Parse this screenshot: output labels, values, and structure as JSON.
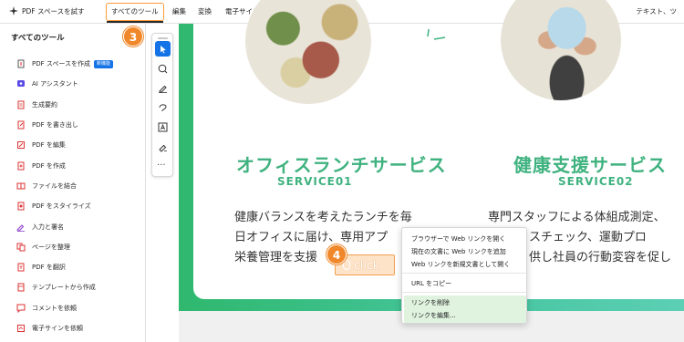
{
  "toolbar": {
    "try_space": "PDF スペースを試す",
    "all_tools": "すべてのツール",
    "edit": "編集",
    "convert": "変換",
    "esign": "電子サイン",
    "right_label": "テキスト、ツ"
  },
  "left_panel": {
    "title": "すべてのツール",
    "items": [
      {
        "label": "PDF スペースを作成",
        "badge": "新機能",
        "icon": "pdf-space-icon"
      },
      {
        "label": "AI アシスタント",
        "icon": "ai-assistant-icon"
      },
      {
        "label": "生成要約",
        "icon": "summary-icon"
      },
      {
        "label": "PDF を書き出し",
        "icon": "export-pdf-icon"
      },
      {
        "label": "PDF を編集",
        "icon": "edit-pdf-icon"
      },
      {
        "label": "PDF を作成",
        "icon": "create-pdf-icon"
      },
      {
        "label": "ファイルを結合",
        "icon": "combine-files-icon"
      },
      {
        "label": "PDF をスタイライズ",
        "icon": "stylize-pdf-icon"
      },
      {
        "label": "入力と署名",
        "icon": "fill-sign-icon"
      },
      {
        "label": "ページを整理",
        "icon": "organize-pages-icon"
      },
      {
        "label": "PDF を翻訳",
        "icon": "translate-pdf-icon"
      },
      {
        "label": "テンプレートから作成",
        "icon": "template-icon"
      },
      {
        "label": "コメントを依頼",
        "icon": "request-comments-icon"
      },
      {
        "label": "電子サインを依頼",
        "icon": "request-esign-icon"
      }
    ]
  },
  "steps": {
    "step3": "3",
    "step4": "4"
  },
  "click_label": "click",
  "document": {
    "service1_title": "オフィスランチサービス",
    "service1_sub": "SERVICE01",
    "service2_title": "健康支援サービス",
    "service2_sub": "SERVICE02",
    "col1_lines": [
      "健康バランスを考えたランチを毎",
      "日オフィスに届け、専用アプ",
      "栄養管理を支援"
    ],
    "col2_lines": [
      "専門スタッフによる体組成測定、",
      "スチェック、運動プロ",
      "供し社員の行動変容を促し"
    ]
  },
  "context_menu": {
    "items": [
      "ブラウザーで Web リンクを開く",
      "現在の文書に Web リンクを追加",
      "Web リンクを新規文書として開く",
      "URL をコピー",
      "リンクを削除",
      "リンクを編集..."
    ]
  },
  "colors": {
    "accent": "#1473e6",
    "step_orange": "#f0882b",
    "service_green": "#3fb27f"
  }
}
